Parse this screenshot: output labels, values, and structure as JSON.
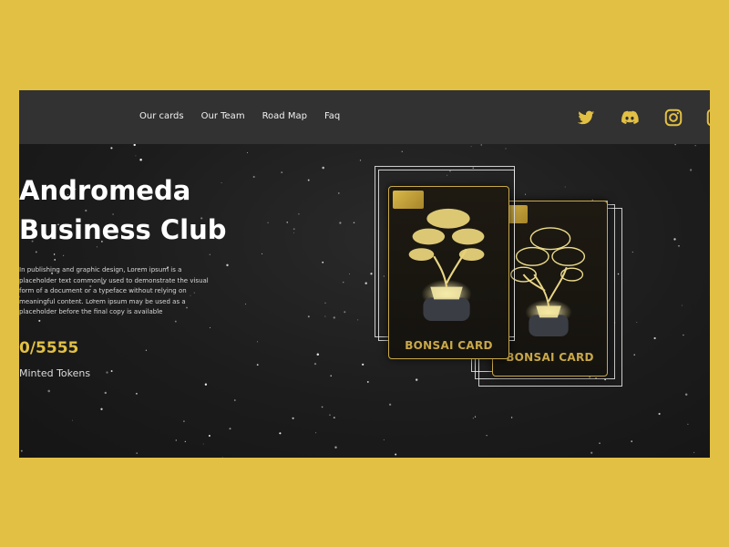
{
  "nav": {
    "links": [
      "Our cards",
      "Our Team",
      "Road Map",
      "Faq"
    ]
  },
  "socials": [
    "twitter-icon",
    "discord-icon",
    "instagram-icon"
  ],
  "hero": {
    "title_line1": "Andromeda",
    "title_line2": "Business Club",
    "description": "In publishing and graphic design, Lorem ipsum is a placeholder text commonly used to demonstrate the visual form of a document or a typeface without relying on meaningful content. Lorem ipsum may be used as a placeholder before the final copy is available",
    "minted_count": "0/5555",
    "minted_label": "Minted Tokens"
  },
  "cards": [
    {
      "title": "BONSAI CARD"
    },
    {
      "title": "BONSAI CARD"
    }
  ],
  "colors": {
    "accent": "#e2c044",
    "nav_bg": "#323232",
    "hero_bg": "#1b1b1b",
    "card_gold": "#c9a84a"
  }
}
